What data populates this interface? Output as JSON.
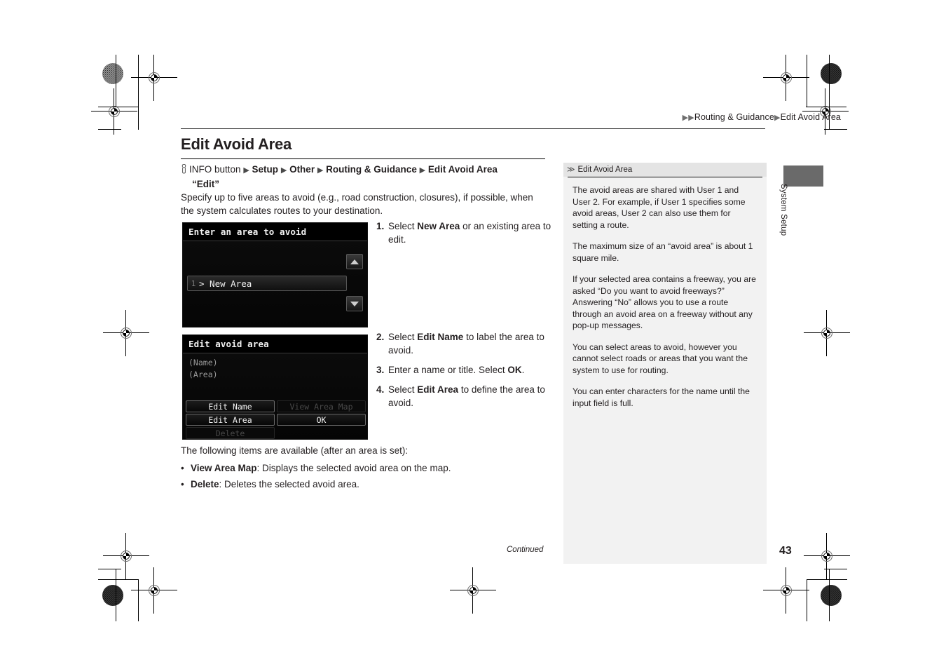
{
  "breadcrumb": {
    "arrow1": "▶",
    "arrow2": "▶",
    "section": "Routing & Guidance",
    "arrow3": "▶",
    "page": "Edit Avoid Area"
  },
  "page_title": "Edit Avoid Area",
  "nav_path": {
    "hand_icon": "hand-press-icon",
    "start": "INFO button",
    "tri": "▶",
    "items": [
      "Setup",
      "Other",
      "Routing & Guidance",
      "Edit Avoid Area"
    ],
    "quoted": "“Edit”"
  },
  "intro": "Specify up to five areas to avoid (e.g., road construction, closures), if possible, when the system calculates routes to your destination.",
  "screens": {
    "screen1": {
      "title": "Enter an area to avoid",
      "row_number": "1",
      "row_label": "> New Area",
      "scroll_up_icon": "triangle-up-icon",
      "scroll_down_icon": "triangle-down-icon"
    },
    "screen2": {
      "title": "Edit avoid area",
      "field_name": "(Name)",
      "field_area": "(Area)",
      "buttons": [
        {
          "label": "Edit Name",
          "state": "enabled"
        },
        {
          "label": "View Area Map",
          "state": "disabled"
        },
        {
          "label": "Edit Area",
          "state": "enabled"
        },
        {
          "label": "OK",
          "state": "enabled"
        },
        {
          "label": "Delete",
          "state": "disabled"
        },
        {
          "label": "",
          "state": "blank"
        }
      ]
    }
  },
  "steps": [
    {
      "n": "1.",
      "pre": "Select ",
      "bold": "New Area",
      "post": " or an existing area to edit."
    },
    {
      "n": "2.",
      "pre": "Select ",
      "bold": "Edit Name",
      "post": " to label the area to avoid."
    },
    {
      "n": "3.",
      "pre": "Enter a name or title. Select ",
      "bold": "OK",
      "post": "."
    },
    {
      "n": "4.",
      "pre": "Select ",
      "bold": "Edit Area",
      "post": " to define the area to avoid."
    }
  ],
  "after": {
    "lead": "The following items are available (after an area is set):",
    "bullets": [
      {
        "dot": "•",
        "bold": "View Area Map",
        "rest": ": Displays the selected avoid area on the map."
      },
      {
        "dot": "•",
        "bold": "Delete",
        "rest": ": Deletes the selected avoid area."
      }
    ]
  },
  "sidebar": {
    "chevron": "≫",
    "title": "Edit Avoid Area",
    "paragraphs": [
      "The avoid areas are shared with User 1 and User 2. For example, if User 1 specifies some avoid areas, User 2 can also use them for setting a route.",
      "The maximum size of an “avoid area” is about 1 square mile.",
      "If your selected area contains a freeway, you are asked “Do you want to avoid freeways?” Answering “No” allows you to use a route through an avoid area on a freeway without any pop-up messages.",
      "You can select areas to avoid, however you cannot select roads or areas that you want the system to use for routing.",
      "You can enter characters for the name until the input field is full."
    ]
  },
  "side_tab": {
    "label": "System Setup"
  },
  "footer": {
    "continued": "Continued",
    "page_number": "43"
  }
}
